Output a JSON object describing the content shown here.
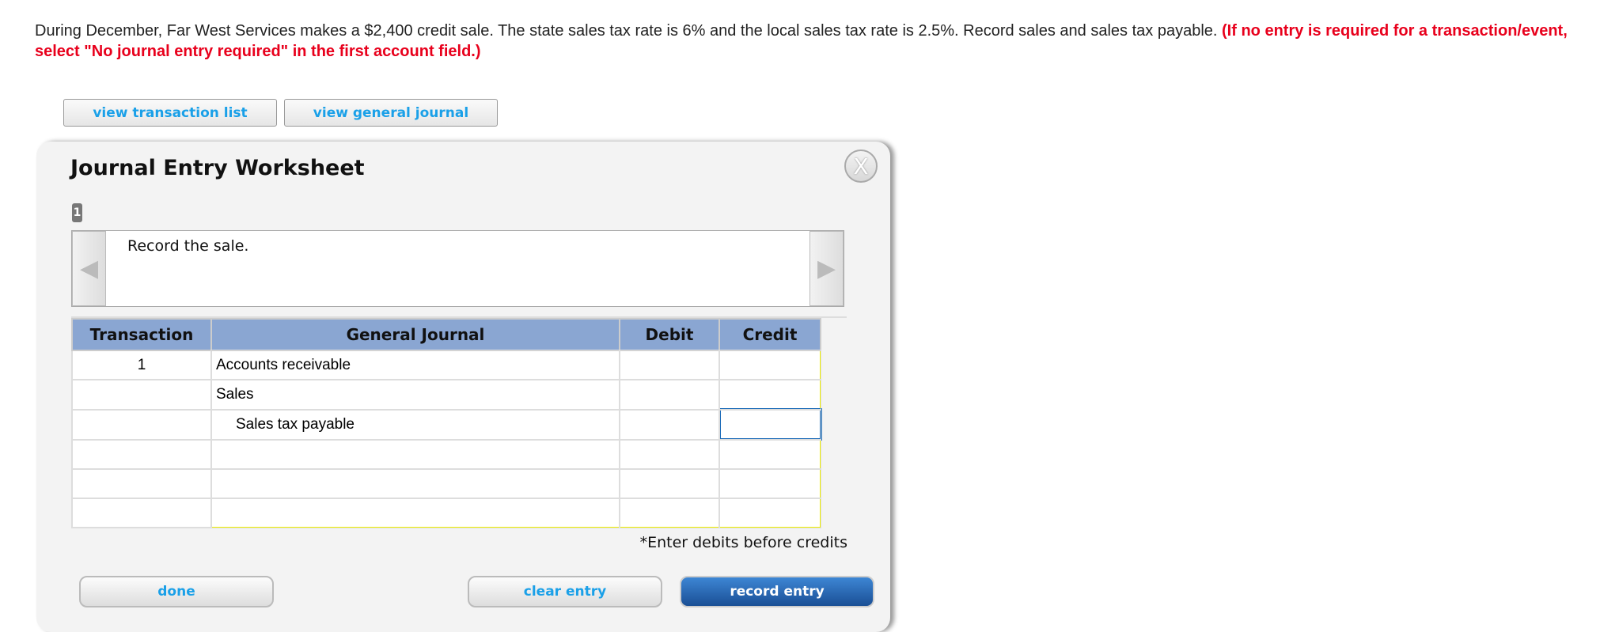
{
  "question": {
    "text": "During December, Far West Services makes a $2,400 credit sale. The state sales tax rate is 6% and the local sales tax rate is 2.5%. Record sales and sales tax payable.",
    "instruction": "(If no entry is required for a transaction/event, select \"No journal entry required\" in the first account field.)"
  },
  "toolbar": {
    "view_transaction_list": "view transaction list",
    "view_general_journal": "view general journal"
  },
  "worksheet": {
    "title": "Journal Entry Worksheet",
    "close_label": "X",
    "step": "1",
    "description": "Record the sale.",
    "note": "*Enter debits before credits"
  },
  "table": {
    "headers": [
      "Transaction",
      "General Journal",
      "Debit",
      "Credit"
    ],
    "rows": [
      {
        "transaction": "1",
        "account": "Accounts receivable",
        "debit": "",
        "credit": ""
      },
      {
        "transaction": "",
        "account": "Sales",
        "debit": "",
        "credit": ""
      },
      {
        "transaction": "",
        "account": "Sales tax payable",
        "debit": "",
        "credit": ""
      },
      {
        "transaction": "",
        "account": "",
        "debit": "",
        "credit": ""
      },
      {
        "transaction": "",
        "account": "",
        "debit": "",
        "credit": ""
      },
      {
        "transaction": "",
        "account": "",
        "debit": "",
        "credit": ""
      }
    ]
  },
  "buttons": {
    "done": "done",
    "clear_entry": "clear entry",
    "record_entry": "record entry"
  },
  "colors": {
    "header": "#8aa6d2",
    "input_border": "#f0f000",
    "focus": "#1a6ab8",
    "link": "#1aa0e8",
    "warning": "#e8001c"
  }
}
